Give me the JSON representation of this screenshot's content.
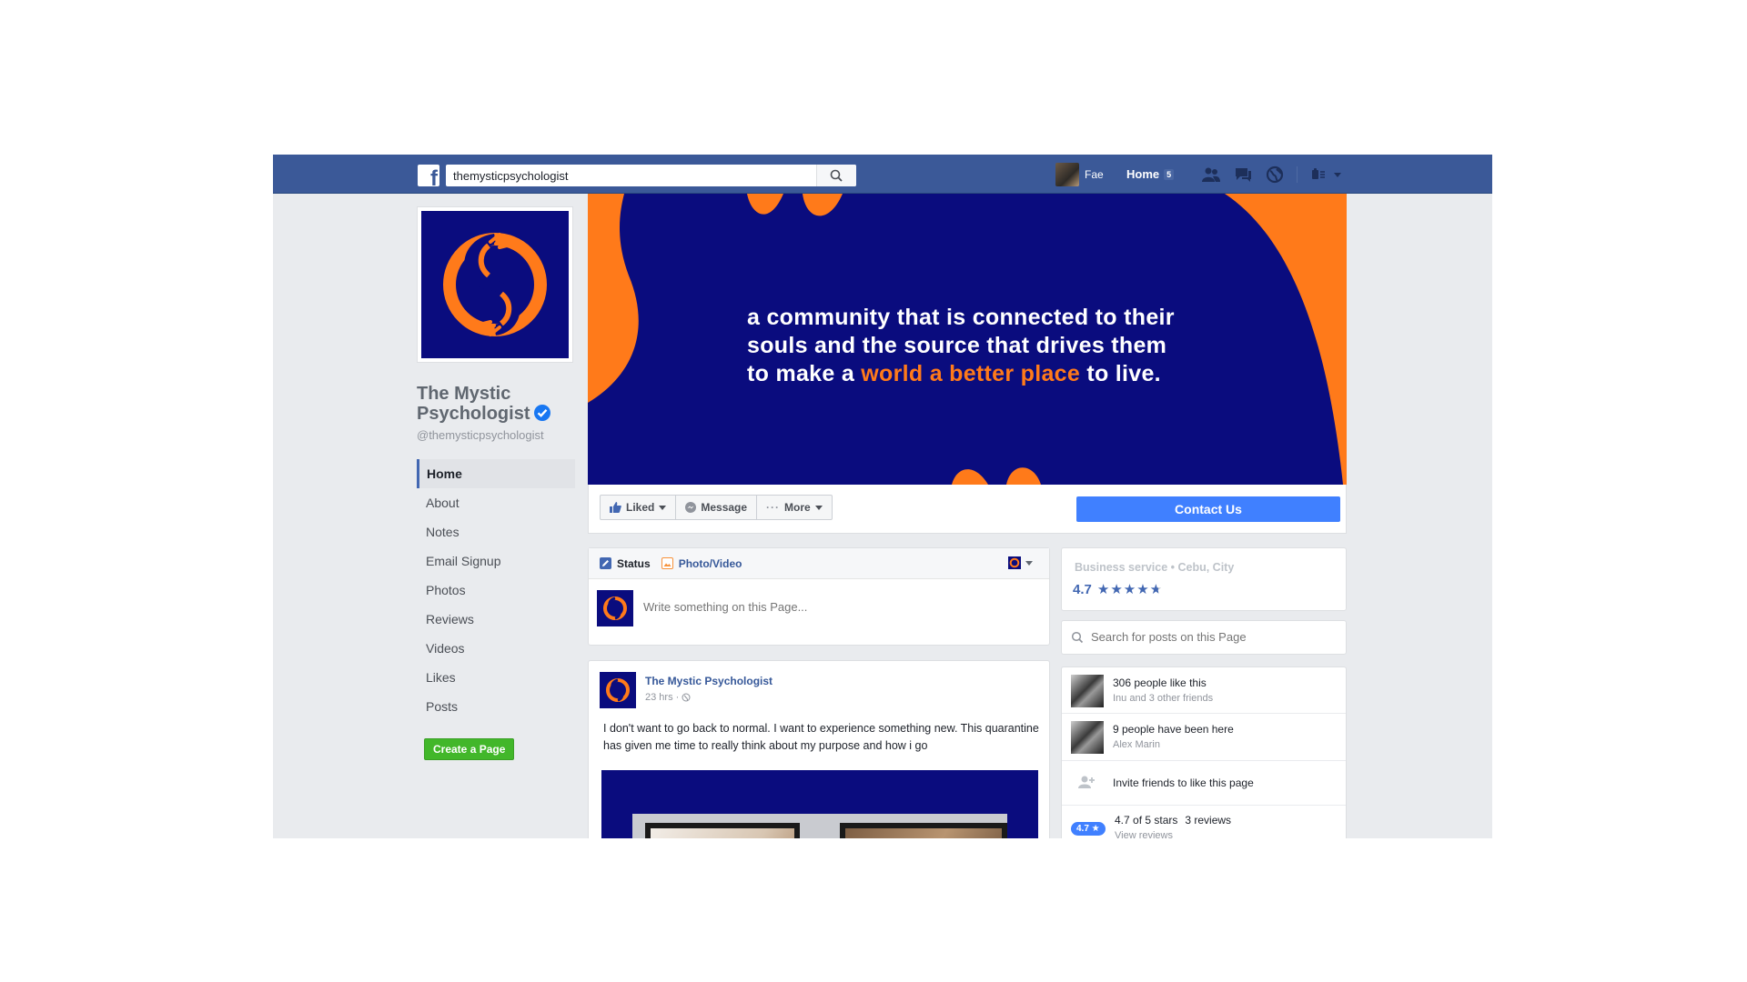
{
  "topbar": {
    "search_value": "themysticpsychologist",
    "user_name": "Fae",
    "home_label": "Home",
    "home_count": "5"
  },
  "profile": {
    "name": "The Mystic Psychologist",
    "handle": "@themysticpsychologist"
  },
  "nav": {
    "items": [
      "Home",
      "About",
      "Notes",
      "Email Signup",
      "Photos",
      "Reviews",
      "Videos",
      "Likes",
      "Posts"
    ],
    "create_page_label": "Create a Page"
  },
  "cover": {
    "line1": "a community that is connected to their",
    "line2": "souls and the source that drives them",
    "line3_before": "to make a ",
    "line3_highlight": "world a better place",
    "line3_after": " to live."
  },
  "actions": {
    "liked_label": "Liked",
    "message_label": "Message",
    "more_label": "More",
    "contact_label": "Contact Us"
  },
  "composer": {
    "status_label": "Status",
    "photo_label": "Photo/Video",
    "placeholder": "Write something on this Page..."
  },
  "post": {
    "author": "The Mystic Psychologist",
    "time": "23 hrs",
    "text": "I don't want to go back to normal. I want to experience something new. This quarantine has given me time to really think about my purpose and how i go"
  },
  "about": {
    "category": "Business service • Cebu, City",
    "rating": "4.7",
    "stars": 4.7
  },
  "post_search": {
    "placeholder": "Search for posts on this Page"
  },
  "community": {
    "likes_title": "306 people like this",
    "likes_sub": "Inu and 3 other friends",
    "visits_title": "9 people have been here",
    "visits_sub": "Alex Marin",
    "invite_text": "Invite friends to like this page",
    "review_badge": "4.7 ★",
    "review_summary": "4.7 of 5 stars",
    "review_count": "3 reviews",
    "view_reviews": "View reviews"
  },
  "colors": {
    "facebook_blue": "#3b5998",
    "brand_navy": "#0a0c7e",
    "brand_orange": "#ff7a1a",
    "contact_button": "#4080ff",
    "create_page_green": "#42b72a"
  }
}
